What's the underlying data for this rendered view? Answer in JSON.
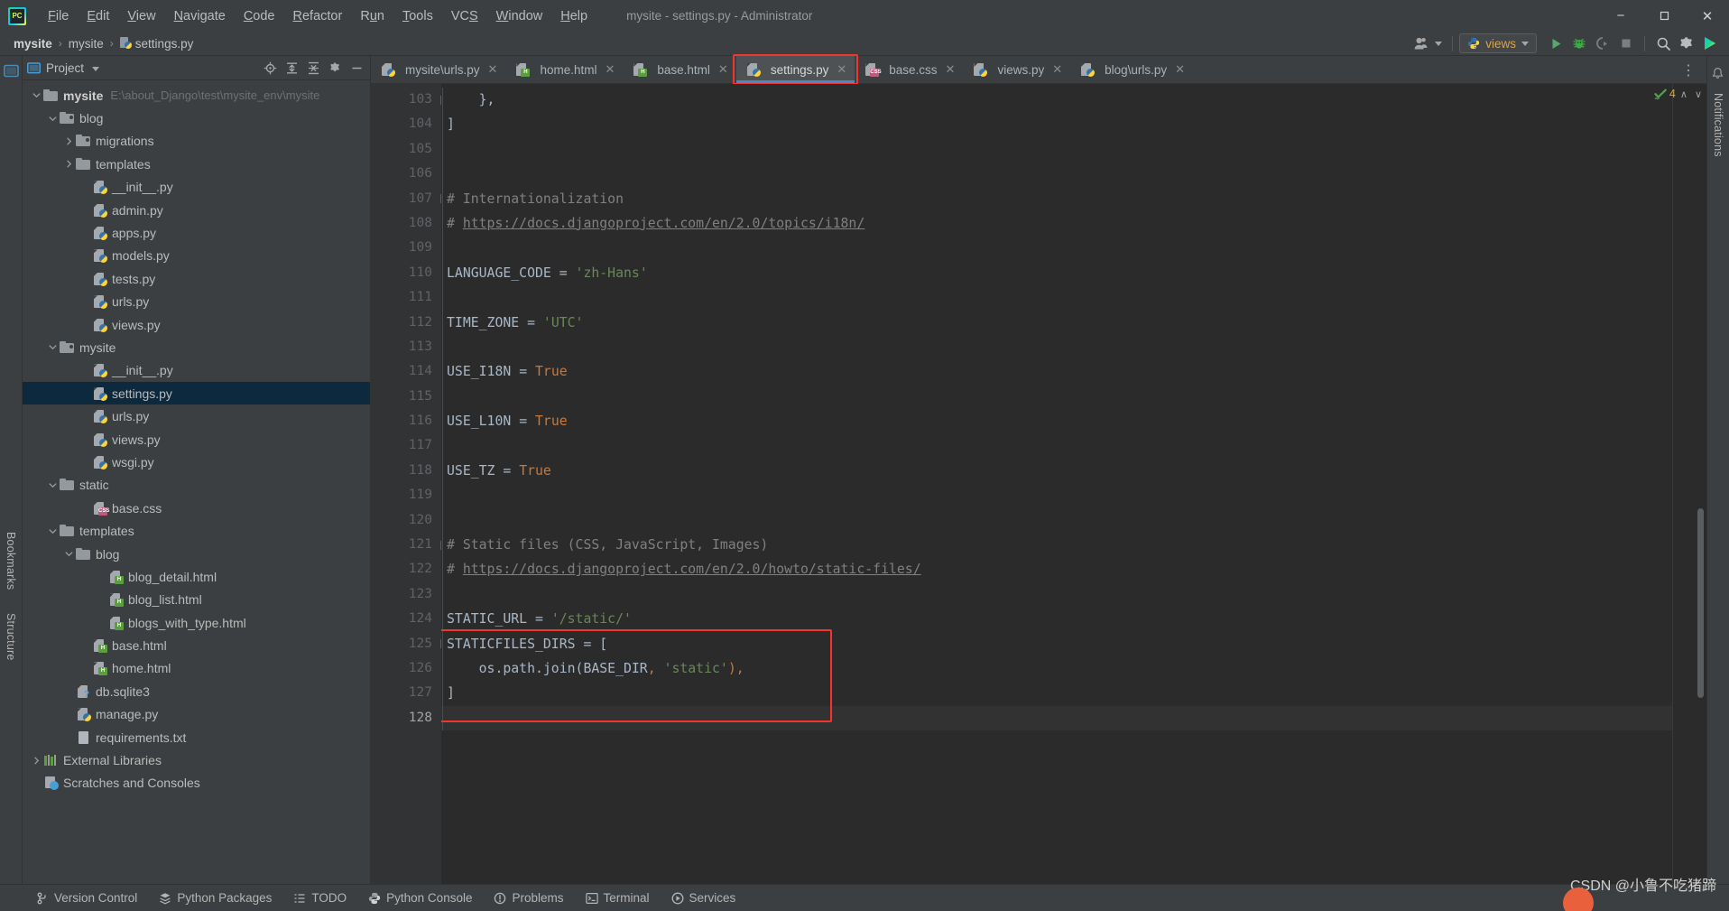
{
  "window": {
    "title": "mysite - settings.py - Administrator",
    "app_icon": "pycharm-logo-icon",
    "controls": {
      "minimize": "−",
      "maximize": "❐",
      "close": "✕"
    }
  },
  "menubar": {
    "items": [
      {
        "label": "File",
        "mnemonic": "F"
      },
      {
        "label": "Edit",
        "mnemonic": "E"
      },
      {
        "label": "View",
        "mnemonic": "V"
      },
      {
        "label": "Navigate",
        "mnemonic": "N"
      },
      {
        "label": "Code",
        "mnemonic": "C"
      },
      {
        "label": "Refactor",
        "mnemonic": "R"
      },
      {
        "label": "Run",
        "mnemonic": "u"
      },
      {
        "label": "Tools",
        "mnemonic": "T"
      },
      {
        "label": "VCS",
        "mnemonic": "S"
      },
      {
        "label": "Window",
        "mnemonic": "W"
      },
      {
        "label": "Help",
        "mnemonic": "H"
      }
    ]
  },
  "breadcrumb": {
    "items": [
      "mysite",
      "mysite",
      "settings.py"
    ],
    "separator": "›"
  },
  "toolbar": {
    "user_icon": "user-accounts-icon",
    "run_config": {
      "label": "views",
      "icon": "python-icon",
      "dropdown": "▾"
    },
    "run_label": "Run",
    "debug_label": "Debug",
    "coverage_label": "Run with Coverage",
    "stop_label": "Stop",
    "search_label": "Search Everywhere",
    "settings_label": "Settings",
    "ide_label": "IDE Services"
  },
  "project_panel": {
    "title": "Project",
    "dropdown": "▾",
    "header_icons": [
      "locate-icon",
      "expand-all-icon",
      "collapse-all-icon",
      "gear-icon",
      "hide-icon"
    ],
    "tree": [
      {
        "depth": 0,
        "label": "mysite",
        "path": "E:\\about_Django\\test\\mysite_env\\mysite",
        "icon": "folder-root",
        "arrow": "down",
        "bold": true,
        "selected": false
      },
      {
        "depth": 1,
        "label": "blog",
        "icon": "folder-source",
        "arrow": "down",
        "selected": false
      },
      {
        "depth": 2,
        "label": "migrations",
        "icon": "folder-source",
        "arrow": "right",
        "selected": false
      },
      {
        "depth": 2,
        "label": "templates",
        "icon": "folder",
        "arrow": "right",
        "selected": false
      },
      {
        "depth": 3,
        "label": "__init__.py",
        "icon": "python-file",
        "arrow": "",
        "selected": false
      },
      {
        "depth": 3,
        "label": "admin.py",
        "icon": "python-file",
        "arrow": "",
        "selected": false
      },
      {
        "depth": 3,
        "label": "apps.py",
        "icon": "python-file",
        "arrow": "",
        "selected": false
      },
      {
        "depth": 3,
        "label": "models.py",
        "icon": "python-file",
        "arrow": "",
        "selected": false
      },
      {
        "depth": 3,
        "label": "tests.py",
        "icon": "python-file",
        "arrow": "",
        "selected": false
      },
      {
        "depth": 3,
        "label": "urls.py",
        "icon": "python-file",
        "arrow": "",
        "selected": false
      },
      {
        "depth": 3,
        "label": "views.py",
        "icon": "python-file",
        "arrow": "",
        "selected": false
      },
      {
        "depth": 1,
        "label": "mysite",
        "icon": "folder-source",
        "arrow": "down",
        "selected": false
      },
      {
        "depth": 3,
        "label": "__init__.py",
        "icon": "python-file",
        "arrow": "",
        "selected": false
      },
      {
        "depth": 3,
        "label": "settings.py",
        "icon": "python-file",
        "arrow": "",
        "selected": true
      },
      {
        "depth": 3,
        "label": "urls.py",
        "icon": "python-file",
        "arrow": "",
        "selected": false
      },
      {
        "depth": 3,
        "label": "views.py",
        "icon": "python-file",
        "arrow": "",
        "selected": false
      },
      {
        "depth": 3,
        "label": "wsgi.py",
        "icon": "python-file",
        "arrow": "",
        "selected": false
      },
      {
        "depth": 1,
        "label": "static",
        "icon": "folder",
        "arrow": "down",
        "selected": false
      },
      {
        "depth": 3,
        "label": "base.css",
        "icon": "css-file",
        "arrow": "",
        "selected": false
      },
      {
        "depth": 1,
        "label": "templates",
        "icon": "folder",
        "arrow": "down",
        "selected": false
      },
      {
        "depth": 2,
        "label": "blog",
        "icon": "folder",
        "arrow": "down",
        "selected": false
      },
      {
        "depth": 4,
        "label": "blog_detail.html",
        "icon": "html-file",
        "arrow": "",
        "selected": false
      },
      {
        "depth": 4,
        "label": "blog_list.html",
        "icon": "html-file",
        "arrow": "",
        "selected": false
      },
      {
        "depth": 4,
        "label": "blogs_with_type.html",
        "icon": "html-file",
        "arrow": "",
        "selected": false
      },
      {
        "depth": 3,
        "label": "base.html",
        "icon": "html-file",
        "arrow": "",
        "selected": false
      },
      {
        "depth": 3,
        "label": "home.html",
        "icon": "html-file",
        "arrow": "",
        "selected": false
      },
      {
        "depth": 2,
        "label": "db.sqlite3",
        "icon": "unknown-file",
        "arrow": "",
        "selected": false
      },
      {
        "depth": 2,
        "label": "manage.py",
        "icon": "python-file",
        "arrow": "",
        "selected": false
      },
      {
        "depth": 2,
        "label": "requirements.txt",
        "icon": "text-file",
        "arrow": "",
        "selected": false
      },
      {
        "depth": 0,
        "label": "External Libraries",
        "icon": "library-icon",
        "arrow": "right",
        "selected": false
      },
      {
        "depth": 0,
        "label": "Scratches and Consoles",
        "icon": "scratches-icon",
        "arrow": "",
        "selected": false
      }
    ]
  },
  "left_rail": {
    "items": [
      "Project",
      "Bookmarks",
      "Structure"
    ]
  },
  "right_rail": {
    "items": [
      "Notifications"
    ]
  },
  "editor_tabs": {
    "close_glyph": "✕",
    "kebab": "⋮",
    "items": [
      {
        "label": "mysite\\urls.py",
        "icon": "python-file",
        "active": false
      },
      {
        "label": "home.html",
        "icon": "html-file",
        "active": false
      },
      {
        "label": "base.html",
        "icon": "html-file",
        "active": false
      },
      {
        "label": "settings.py",
        "icon": "python-file",
        "active": true
      },
      {
        "label": "base.css",
        "icon": "css-file",
        "active": false
      },
      {
        "label": "views.py",
        "icon": "python-file",
        "active": false
      },
      {
        "label": "blog\\urls.py",
        "icon": "python-file",
        "active": false
      }
    ]
  },
  "editor": {
    "filename": "settings.py",
    "first_line": 103,
    "current_line": 128,
    "inspection": {
      "count": "4",
      "status": "ok",
      "up": "∧",
      "down": "∨"
    },
    "lines": [
      {
        "n": 103,
        "fold": "minus",
        "tokens": [
          {
            "t": "    },",
            "c": "op"
          }
        ]
      },
      {
        "n": 104,
        "fold": "end",
        "tokens": [
          {
            "t": "]",
            "c": "op"
          }
        ]
      },
      {
        "n": 105,
        "fold": "",
        "tokens": []
      },
      {
        "n": 106,
        "fold": "",
        "tokens": []
      },
      {
        "n": 107,
        "fold": "minus",
        "tokens": [
          {
            "t": "# Internationalization",
            "c": "com"
          }
        ]
      },
      {
        "n": 108,
        "fold": "end",
        "tokens": [
          {
            "t": "# ",
            "c": "com"
          },
          {
            "t": "https://docs.djangoproject.com/en/2.0/topics/i18n/",
            "c": "link"
          }
        ]
      },
      {
        "n": 109,
        "fold": "",
        "tokens": []
      },
      {
        "n": 110,
        "fold": "",
        "tokens": [
          {
            "t": "LANGUAGE_CODE ",
            "c": "var"
          },
          {
            "t": "= ",
            "c": "op"
          },
          {
            "t": "'zh-Hans'",
            "c": "str"
          }
        ]
      },
      {
        "n": 111,
        "fold": "",
        "tokens": []
      },
      {
        "n": 112,
        "fold": "",
        "tokens": [
          {
            "t": "TIME_ZONE ",
            "c": "var"
          },
          {
            "t": "= ",
            "c": "op"
          },
          {
            "t": "'UTC'",
            "c": "str"
          }
        ]
      },
      {
        "n": 113,
        "fold": "",
        "tokens": []
      },
      {
        "n": 114,
        "fold": "",
        "tokens": [
          {
            "t": "USE_I18N ",
            "c": "var"
          },
          {
            "t": "= ",
            "c": "op"
          },
          {
            "t": "True",
            "c": "kw"
          }
        ]
      },
      {
        "n": 115,
        "fold": "",
        "tokens": []
      },
      {
        "n": 116,
        "fold": "",
        "tokens": [
          {
            "t": "USE_L10N ",
            "c": "var"
          },
          {
            "t": "= ",
            "c": "op"
          },
          {
            "t": "True",
            "c": "kw"
          }
        ]
      },
      {
        "n": 117,
        "fold": "",
        "tokens": []
      },
      {
        "n": 118,
        "fold": "",
        "tokens": [
          {
            "t": "USE_TZ ",
            "c": "var"
          },
          {
            "t": "= ",
            "c": "op"
          },
          {
            "t": "True",
            "c": "kw"
          }
        ]
      },
      {
        "n": 119,
        "fold": "",
        "tokens": []
      },
      {
        "n": 120,
        "fold": "",
        "tokens": []
      },
      {
        "n": 121,
        "fold": "minus",
        "tokens": [
          {
            "t": "# Static files (CSS, JavaScript, Images)",
            "c": "com"
          }
        ]
      },
      {
        "n": 122,
        "fold": "end",
        "tokens": [
          {
            "t": "# ",
            "c": "com"
          },
          {
            "t": "https://docs.djangoproject.com/en/2.0/howto/static-files/",
            "c": "link"
          }
        ]
      },
      {
        "n": 123,
        "fold": "",
        "tokens": []
      },
      {
        "n": 124,
        "fold": "",
        "tokens": [
          {
            "t": "STATIC_URL ",
            "c": "var"
          },
          {
            "t": "= ",
            "c": "op"
          },
          {
            "t": "'/static/'",
            "c": "str"
          }
        ]
      },
      {
        "n": 125,
        "fold": "minus",
        "tokens": [
          {
            "t": "STATICFILES_DIRS ",
            "c": "var"
          },
          {
            "t": "= [",
            "c": "op"
          }
        ]
      },
      {
        "n": 126,
        "fold": "",
        "tokens": [
          {
            "t": "    os.path.join(BASE_DIR",
            "c": "var"
          },
          {
            "t": ", ",
            "c": "punc"
          },
          {
            "t": "'static'",
            "c": "str"
          },
          {
            "t": "),",
            "c": "punc"
          }
        ]
      },
      {
        "n": 127,
        "fold": "end",
        "tokens": [
          {
            "t": "]",
            "c": "op"
          }
        ]
      },
      {
        "n": 128,
        "fold": "",
        "tokens": []
      }
    ],
    "annotations": [
      {
        "name": "staticfiles-dirs-highlight",
        "from_line": 125,
        "to_line": 128,
        "color": "#f4352e"
      }
    ]
  },
  "statusbar": {
    "items": [
      {
        "label": "Version Control",
        "icon": "branch-icon"
      },
      {
        "label": "Python Packages",
        "icon": "packages-icon"
      },
      {
        "label": "TODO",
        "icon": "todo-icon"
      },
      {
        "label": "Python Console",
        "icon": "python-icon"
      },
      {
        "label": "Problems",
        "icon": "problems-icon"
      },
      {
        "label": "Terminal",
        "icon": "terminal-icon"
      },
      {
        "label": "Services",
        "icon": "services-icon"
      }
    ]
  },
  "watermark": {
    "text": "CSDN @小鲁不吃猪蹄"
  },
  "colors": {
    "accent_blue": "#4a88c7",
    "annotation_red": "#f4352e",
    "selection_blue": "#0d293e",
    "editor_bg": "#2b2b2b",
    "panel_bg": "#3c3f41",
    "string_green": "#6a8759",
    "keyword_orange": "#cc7832",
    "comment_gray": "#808080"
  }
}
